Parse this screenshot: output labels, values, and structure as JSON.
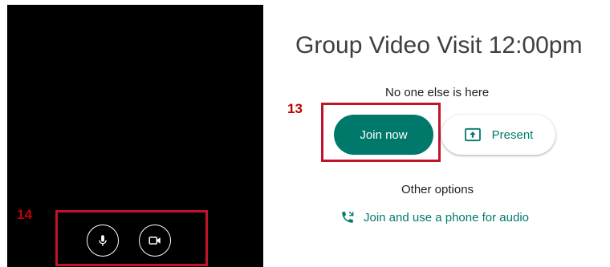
{
  "preview": {
    "marker_label": "14",
    "mic_icon": "microphone-icon",
    "camera_icon": "video-camera-icon"
  },
  "meeting": {
    "title": "Group Video Visit 12:00pm",
    "status_text": "No one else is here",
    "marker_label": "13",
    "join_label": "Join now",
    "present_label": "Present",
    "present_icon": "present-screen-icon",
    "other_options_label": "Other options",
    "phone_link_label": "Join and use a phone for audio",
    "phone_icon": "phone-call-icon"
  },
  "colors": {
    "accent": "#00796b",
    "highlight": "#c0142a",
    "marker": "#c00000",
    "preview_background": "#000000"
  }
}
